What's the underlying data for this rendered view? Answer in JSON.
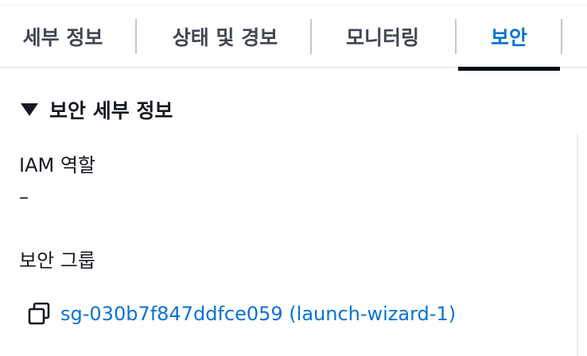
{
  "tabs": [
    {
      "label": "세부 정보",
      "active": false
    },
    {
      "label": "상태 및 경보",
      "active": false
    },
    {
      "label": "모니터링",
      "active": false
    },
    {
      "label": "보안",
      "active": true
    }
  ],
  "security": {
    "section_title": "보안 세부 정보",
    "iam_role": {
      "label": "IAM 역할",
      "value": "–"
    },
    "security_groups": {
      "label": "보안 그룹",
      "items": [
        {
          "link_text": "sg-030b7f847ddfce059 (launch-wizard-1)",
          "icon": "copy-icon"
        }
      ]
    }
  },
  "colors": {
    "accent": "#0972d3",
    "text": "#16191f",
    "tab_text": "#414750",
    "active_underline": "#000716"
  }
}
